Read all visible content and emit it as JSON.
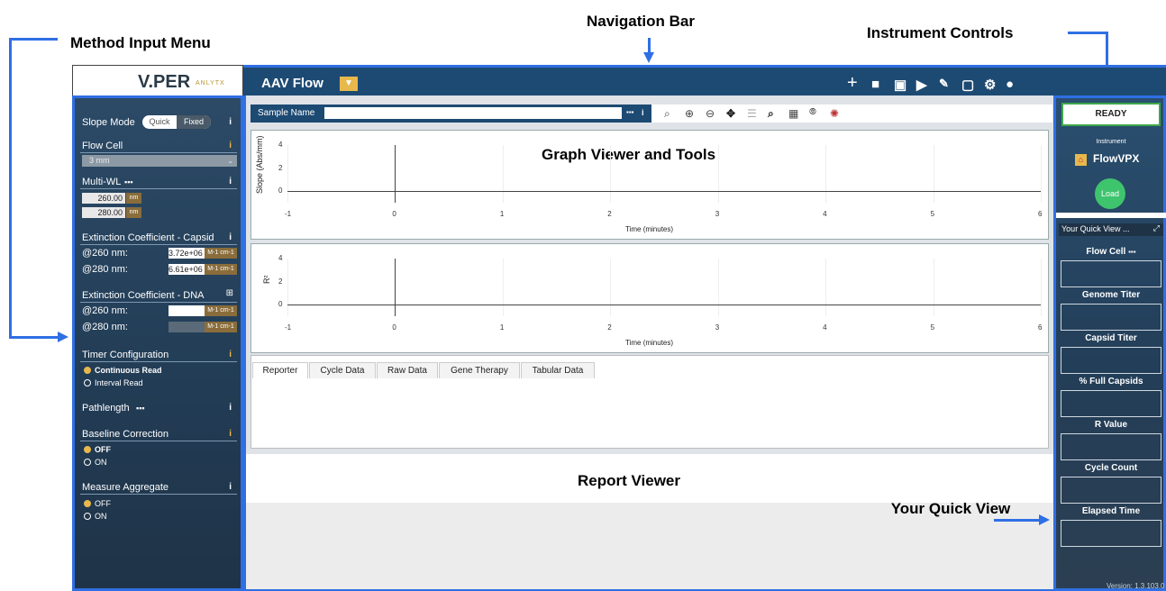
{
  "callouts": {
    "method_input_menu": "Method Input Menu",
    "navigation_bar": "Navigation Bar",
    "instrument_controls": "Instrument Controls",
    "graph_viewer": "Graph Viewer and Tools",
    "report_viewer": "Report Viewer",
    "your_quick_view": "Your Quick View"
  },
  "logo": {
    "text": "V.PER",
    "sub": "ANLYTX"
  },
  "nav": {
    "title": "AAV Flow",
    "icons": [
      "plus-icon",
      "folder-icon",
      "save-icon",
      "export-icon",
      "signature-icon",
      "window-icon",
      "gear-icon",
      "user-icon"
    ]
  },
  "sidebar": {
    "slope_mode": {
      "label": "Slope Mode",
      "options": [
        "Quick",
        "Fixed"
      ],
      "selected": "Fixed"
    },
    "flow_cell": {
      "label": "Flow Cell",
      "value": "3 mm"
    },
    "multi_wl": {
      "label": "Multi-WL",
      "values": [
        "260.00",
        "280.00"
      ],
      "unit": "nm"
    },
    "ext_capsid": {
      "label": "Extinction Coefficient - Capsid",
      "rows": [
        {
          "label": "@260 nm:",
          "value": "3.72e+06"
        },
        {
          "label": "@280 nm:",
          "value": "6.61e+06"
        }
      ],
      "unit": "M-1 cm-1"
    },
    "ext_dna": {
      "label": "Extinction Coefficient - DNA",
      "rows": [
        {
          "label": "@260 nm:",
          "value": ""
        },
        {
          "label": "@280 nm:",
          "value": ""
        }
      ],
      "unit": "M-1 cm-1"
    },
    "timer": {
      "label": "Timer Configuration",
      "options": [
        "Continuous Read",
        "Interval Read"
      ],
      "selected": "Continuous Read"
    },
    "pathlength": {
      "label": "Pathlength"
    },
    "baseline": {
      "label": "Baseline Correction",
      "options": [
        "OFF",
        "ON"
      ],
      "selected": "OFF"
    },
    "aggregate": {
      "label": "Measure Aggregate",
      "options": [
        "OFF",
        "ON"
      ],
      "selected": "OFF"
    },
    "info_glyph": "i"
  },
  "sample": {
    "label": "Sample Name",
    "value": ""
  },
  "chart_data": [
    {
      "type": "line",
      "ylabel": "Slope (Abs/mm)",
      "xlabel": "Time (minutes)",
      "xlim": [
        -1,
        6
      ],
      "ylim": [
        -1,
        4
      ],
      "x_ticks": [
        "-1",
        "0",
        "1",
        "2",
        "3",
        "4",
        "5",
        "6"
      ],
      "y_ticks": [
        "4",
        "2",
        "0"
      ],
      "series": []
    },
    {
      "type": "line",
      "ylabel": "R²",
      "xlabel": "Time (minutes)",
      "xlim": [
        -1,
        6
      ],
      "ylim": [
        -1,
        4
      ],
      "x_ticks": [
        "-1",
        "0",
        "1",
        "2",
        "3",
        "4",
        "5",
        "6"
      ],
      "y_ticks": [
        "4",
        "2",
        "0"
      ],
      "series": []
    }
  ],
  "tabs": [
    "Reporter",
    "Cycle Data",
    "Raw Data",
    "Gene Therapy",
    "Tabular Data"
  ],
  "instrument": {
    "status": "READY",
    "label": "Instrument",
    "name": "FlowVPX",
    "load": "Load"
  },
  "quick_view": {
    "title": "Your Quick View ...",
    "items": [
      "Flow Cell",
      "Genome Titer",
      "Capsid Titer",
      "% Full Capsids",
      "R Value",
      "Cycle Count",
      "Elapsed Time"
    ],
    "version": "Version: 1.3.103.0"
  },
  "colors": {
    "accent": "#2f6fe4",
    "nav": "#1d4a73",
    "sidebar": "#2c4a66",
    "ready_border": "#3ea84a",
    "load": "#3ec46d",
    "unit": "#8a6d3b"
  }
}
